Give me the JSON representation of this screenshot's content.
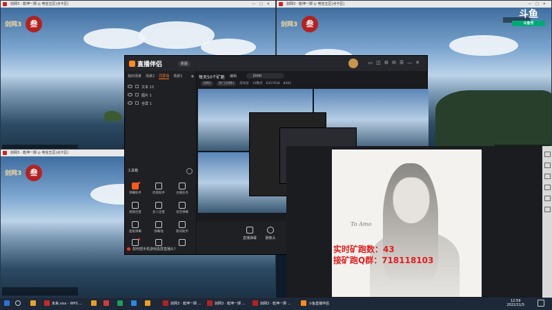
{
  "windows": [
    {
      "id": "tl",
      "title": "剑网3 · 乾坤一掷 ◎ 电信五区(点卡区)",
      "logo": "剑网3",
      "logo_badge": "叁"
    },
    {
      "id": "tr",
      "title": "剑网3 · 乾坤一掷 ◎ 电信五区(点卡区)",
      "logo": "剑网3",
      "logo_badge": "叁"
    },
    {
      "id": "bl",
      "title": "剑网3 · 乾坤一掷 ◎ 电信五区(点卡区)",
      "logo": "剑网3",
      "logo_badge": "叁"
    }
  ],
  "watermark": {
    "text": "斗鱼",
    "sub": "斗鱼号"
  },
  "app": {
    "brand": "直播伴侣",
    "version": "新版",
    "scene_tabs": [
      {
        "label": "我的场景",
        "active": false
      },
      {
        "label": "场景2",
        "active": false
      },
      {
        "label": "同屏场",
        "active": true
      },
      {
        "label": "场景1",
        "active": false
      }
    ],
    "scenes": [
      {
        "label": "文本 13"
      },
      {
        "label": "图片 1"
      },
      {
        "label": "全屏 1"
      }
    ],
    "toolbox_title": "工具箱",
    "tools": [
      {
        "label": "弹幕助手",
        "highlight": true,
        "dot": true
      },
      {
        "label": "房管助手",
        "highlight": false,
        "dot": false
      },
      {
        "label": "主播任务",
        "highlight": false,
        "dot": false
      },
      {
        "label": "视频连麦",
        "highlight": false,
        "dot": false
      },
      {
        "label": "多人连麦",
        "highlight": false,
        "dot": false
      },
      {
        "label": "语音弹幕",
        "highlight": false,
        "dot": false
      },
      {
        "label": "超级弹幕",
        "highlight": false,
        "dot": false
      },
      {
        "label": "弹幕墙",
        "highlight": false,
        "dot": false
      },
      {
        "label": "歌词助手",
        "highlight": false,
        "dot": false
      },
      {
        "label": "",
        "highlight": false,
        "dot": true
      },
      {
        "label": "",
        "highlight": false,
        "dot": false
      },
      {
        "label": "",
        "highlight": false,
        "dot": false
      }
    ],
    "tip": "如何把手机游戏投屏直播头?",
    "stream_title": "每天50个矿跑",
    "edit": "编辑",
    "game": "jjxpp",
    "meta": {
      "chip1": "剑网3",
      "chip2": "热门/剑网3",
      "room": "房间号",
      "tag": "10整点",
      "uid": "6357618",
      "viewers": "8492"
    },
    "bottom": [
      {
        "label": "直播弹幕"
      },
      {
        "label": "摄像头"
      }
    ]
  },
  "overlay": {
    "signature": "To Amo",
    "line1": "实时矿跑数：43",
    "line2": "接矿跑Q群：718118103"
  },
  "taskbar": {
    "items": [
      {
        "label": "",
        "color": "#2f72d6"
      },
      {
        "label": "",
        "color": "#3aa0ff"
      },
      {
        "label": "",
        "color": "#e6a52a"
      },
      {
        "label": "未来.xlsx - WPS ...",
        "color": "#c82a2a"
      },
      {
        "label": "",
        "color": "#e0a020"
      },
      {
        "label": "",
        "color": "#d23a3a"
      },
      {
        "label": "",
        "color": "#e05a2a"
      },
      {
        "label": "",
        "color": "#1c9e5a"
      },
      {
        "label": "",
        "color": "#2d86e0"
      },
      {
        "label": "",
        "color": "#f0a020"
      },
      {
        "label": "",
        "color": "#7a5bd0"
      },
      {
        "label": "",
        "color": "#a0a0a0"
      }
    ],
    "games": [
      {
        "label": "剑网3 · 乾坤一掷 ..."
      },
      {
        "label": "剑网3 · 乾坤一掷 ..."
      },
      {
        "label": "剑网3 · 乾坤一掷 ..."
      },
      {
        "label": "斗鱼直播伴侣"
      }
    ],
    "time": "12:59",
    "date": "2022/11/5"
  }
}
